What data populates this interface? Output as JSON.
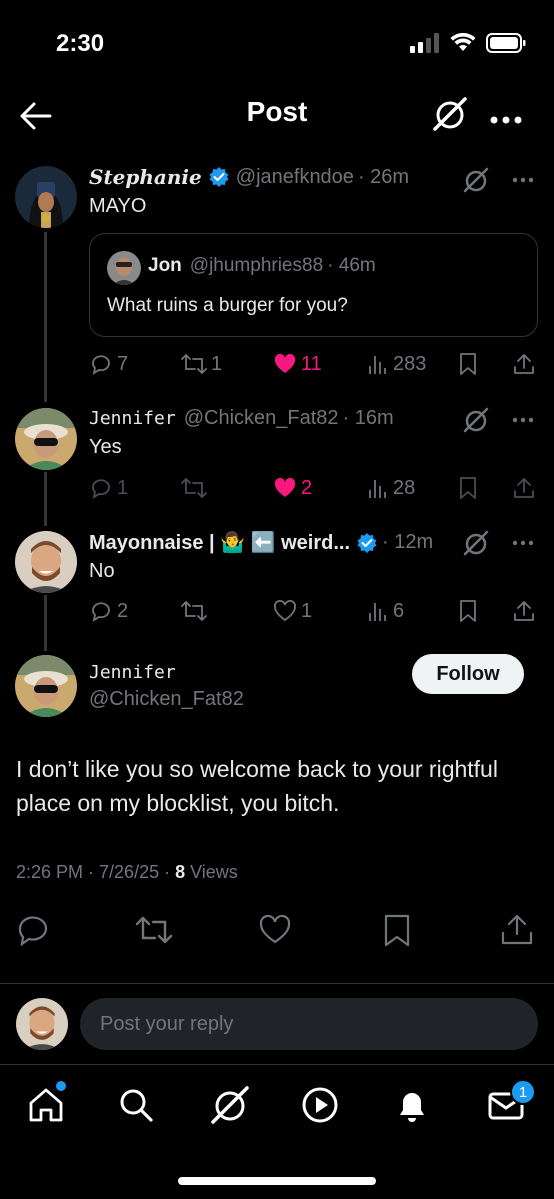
{
  "status_bar": {
    "time": "2:30"
  },
  "header": {
    "title": "Post"
  },
  "thread": [
    {
      "name": "Stephanie",
      "verified": true,
      "handle": "@janefkndoe",
      "time": "· 26m",
      "text": "MAYO",
      "quote": {
        "name": "Jon",
        "handle": "@jhumphries88",
        "time": "· 46m",
        "text": "What ruins a burger for you?"
      },
      "actions": {
        "replies": "7",
        "reposts": "1",
        "likes": "11",
        "views": "283"
      }
    },
    {
      "name": "Jennifer",
      "handle": "@Chicken_Fat82",
      "time": "· 16m",
      "text": "Yes",
      "actions": {
        "replies": "1",
        "reposts": "",
        "likes": "2",
        "views": "28"
      }
    },
    {
      "name": "Mayonnaise | 🤷‍♂️ ⬅️ weird...",
      "verified": true,
      "handle": "",
      "time": "· 12m",
      "text": "No",
      "actions": {
        "replies": "2",
        "reposts": "",
        "likes": "1",
        "views": "6"
      }
    }
  ],
  "main_post": {
    "name": "Jennifer",
    "handle": "@Chicken_Fat82",
    "follow_label": "Follow",
    "text": "I don’t like you so welcome back to your rightful place on my blocklist, you bitch.",
    "timestamp": "2:26 PM · 7/26/25 · ",
    "views_count": "8",
    "views_label": " Views"
  },
  "reply": {
    "placeholder": "Post your reply"
  },
  "tab_bar": {
    "messages_badge": "1"
  },
  "colors": {
    "like": "#f91880",
    "verified": "#1d9bf0",
    "muted": "#71767b"
  }
}
